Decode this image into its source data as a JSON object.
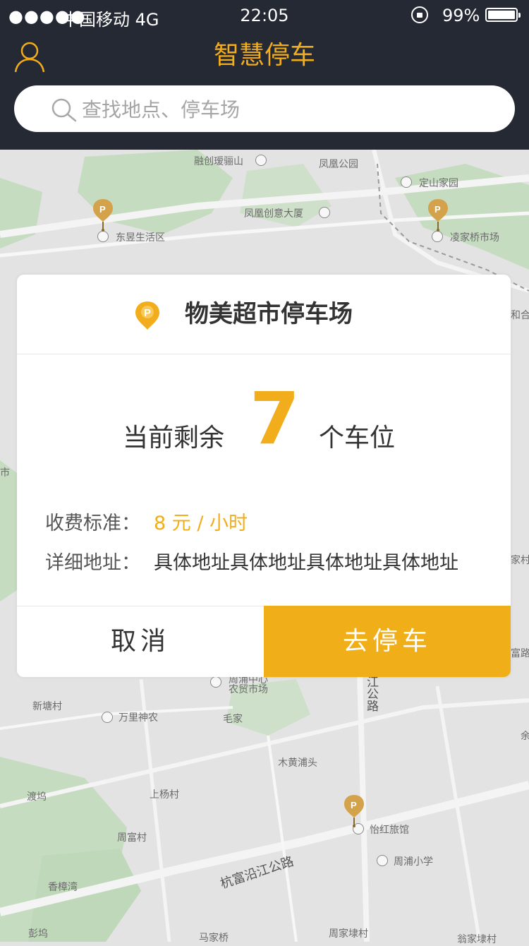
{
  "status_bar": {
    "signal": "●●●●●",
    "carrier": "中国移动  4G",
    "time": "22:05",
    "battery": "99%"
  },
  "header": {
    "title": "智慧停车",
    "search_placeholder": "查找地点、停车场"
  },
  "map": {
    "labels": {
      "rongchuang": "融创瑷骊山",
      "fenghuang_park": "凤凰公园",
      "dingshan": "定山家园",
      "fenghuang_building": "凤凰创意大厦",
      "dongyu": "东昱生活区",
      "lingjiaqiao": "凌家桥市场",
      "hehe": "和合",
      "market_edge": "市",
      "zhoupu_market_a": "周浦中心",
      "zhoupu_market_b": "农贸市场",
      "jiang_road": "江公路",
      "xintang": "新塘村",
      "wanli": "万里神农",
      "maojia": "毛家",
      "muhuangpu": "木黄浦头",
      "dukou": "渡坞",
      "shangyang": "上杨村",
      "zhoufu": "周富村",
      "yihong": "怡红旅馆",
      "zhoupu_school": "周浦小学",
      "road_hangfu": "杭富沿江公路",
      "xiangzhang": "香樟湾",
      "pengwu": "彭坞",
      "majiaqiao": "马家桥",
      "zhoujia": "周家埭村",
      "right_jia": "家村",
      "right_fu": "富路",
      "right_yu": "余",
      "bottom_right": "翁家埭村"
    }
  },
  "card": {
    "name": "物美超市停车场",
    "remaining_prefix": "当前剩余",
    "remaining_count": "7",
    "remaining_suffix": "个车位",
    "fee_label": "收费标准：",
    "fee_value": "8 元 / 小时",
    "address_label": "详细地址：",
    "address_value": "具体地址具体地址具体地址具体地址",
    "cancel_label": "取消",
    "go_label": "去停车"
  },
  "colors": {
    "accent": "#f2ad1c",
    "nav_bg": "#252934",
    "button_bg": "#f0ae18"
  },
  "icons": {
    "profile": "user-icon",
    "search": "search-icon",
    "parking_marker": "parking-pin-icon",
    "lock": "orientation-lock-icon",
    "battery": "battery-icon"
  }
}
